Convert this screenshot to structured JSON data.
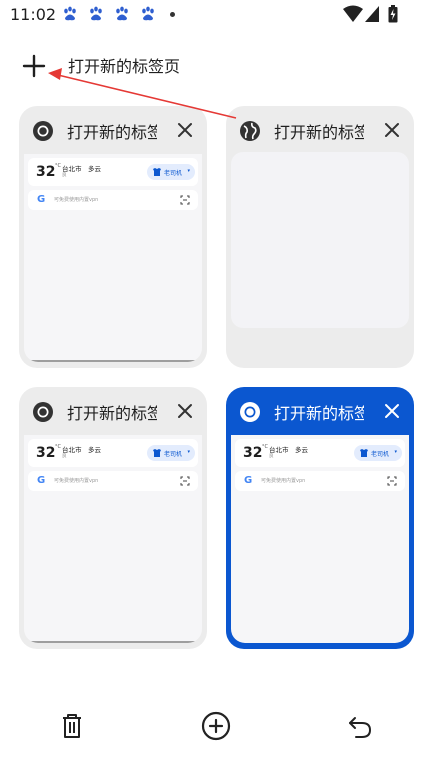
{
  "status_bar": {
    "time": "11:02",
    "icons": [
      "baidu-paw-icon",
      "baidu-paw-icon",
      "baidu-paw-icon",
      "baidu-paw-icon",
      "dot-icon",
      "wifi-icon",
      "signal-icon",
      "battery-icon"
    ]
  },
  "new_tab": {
    "icon": "plus-icon",
    "label": "打开新的标签页"
  },
  "tabs": [
    {
      "title": "打开新的标签页",
      "favicon": "chrome-icon",
      "active": false,
      "preview": {
        "temp": "32",
        "deg": "°C",
        "city": "台北市",
        "condition": "多云",
        "aqi": "良",
        "user": "老司机",
        "search_placeholder": "可免费使用内置vpn"
      }
    },
    {
      "title": "打开新的标签页",
      "favicon": "globe-icon",
      "active": false,
      "preview": null
    },
    {
      "title": "打开新的标签页",
      "favicon": "chrome-icon",
      "active": false,
      "preview": {
        "temp": "32",
        "deg": "°C",
        "city": "台北市",
        "condition": "多云",
        "aqi": "良",
        "user": "老司机",
        "search_placeholder": "可免费使用内置vpn"
      }
    },
    {
      "title": "打开新的标签页",
      "favicon": "chrome-icon",
      "active": true,
      "preview": {
        "temp": "32",
        "deg": "°C",
        "city": "台北市",
        "condition": "多云",
        "aqi": "良",
        "user": "老司机",
        "search_placeholder": "可免费使用内置vpn"
      }
    }
  ],
  "bottom_bar": {
    "buttons": [
      "delete-icon",
      "add-circle-icon",
      "undo-icon"
    ]
  },
  "colors": {
    "accent": "#0b57d0",
    "card_bg": "#ececec",
    "annotation": "#e53935"
  }
}
